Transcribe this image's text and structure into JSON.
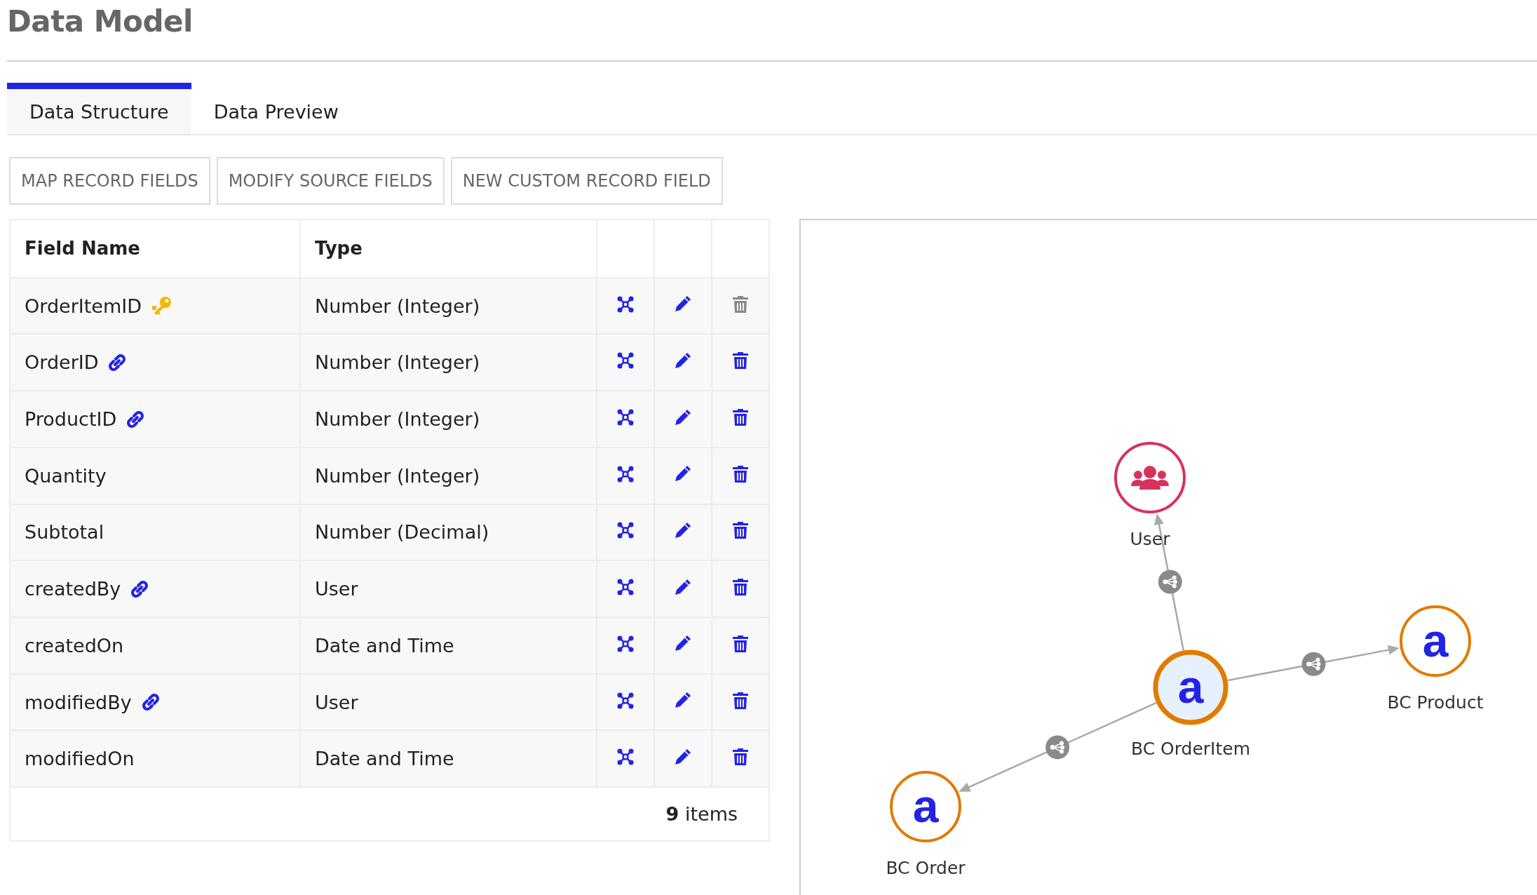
{
  "title": "Data Model",
  "tabs": [
    {
      "label": "Data Structure",
      "selected": true
    },
    {
      "label": "Data Preview",
      "selected": false
    }
  ],
  "buttons": [
    "MAP RECORD FIELDS",
    "MODIFY SOURCE FIELDS",
    "NEW CUSTOM RECORD FIELD"
  ],
  "table": {
    "columns": [
      "Field Name",
      "Type"
    ],
    "rows": [
      {
        "field_name": "OrderItemID",
        "kind": "key",
        "type": "Number (Integer)",
        "delete_disabled": true
      },
      {
        "field_name": "OrderID",
        "kind": "link",
        "type": "Number (Integer)",
        "delete_disabled": false
      },
      {
        "field_name": "ProductID",
        "kind": "link",
        "type": "Number (Integer)",
        "delete_disabled": false
      },
      {
        "field_name": "Quantity",
        "type": "Number (Integer)",
        "delete_disabled": false
      },
      {
        "field_name": "Subtotal",
        "type": "Number (Decimal)",
        "delete_disabled": false
      },
      {
        "field_name": "createdBy",
        "kind": "link",
        "type": "User",
        "delete_disabled": false
      },
      {
        "field_name": "createdOn",
        "type": "Date and Time",
        "delete_disabled": false
      },
      {
        "field_name": "modifiedBy",
        "kind": "link",
        "type": "User",
        "delete_disabled": false
      },
      {
        "field_name": "modifiedOn",
        "type": "Date and Time",
        "delete_disabled": false
      }
    ],
    "footer": "**9** items"
  },
  "graph": {
    "nodes": [
      {
        "label": "User",
        "kind": "user",
        "selected": false
      },
      {
        "label": "BC OrderItem",
        "kind": "record",
        "glyph": "a",
        "selected": true
      },
      {
        "label": "BC Product",
        "kind": "record",
        "glyph": "a",
        "selected": false
      },
      {
        "label": "BC Order",
        "kind": "record",
        "glyph": "a",
        "selected": false
      }
    ]
  }
}
